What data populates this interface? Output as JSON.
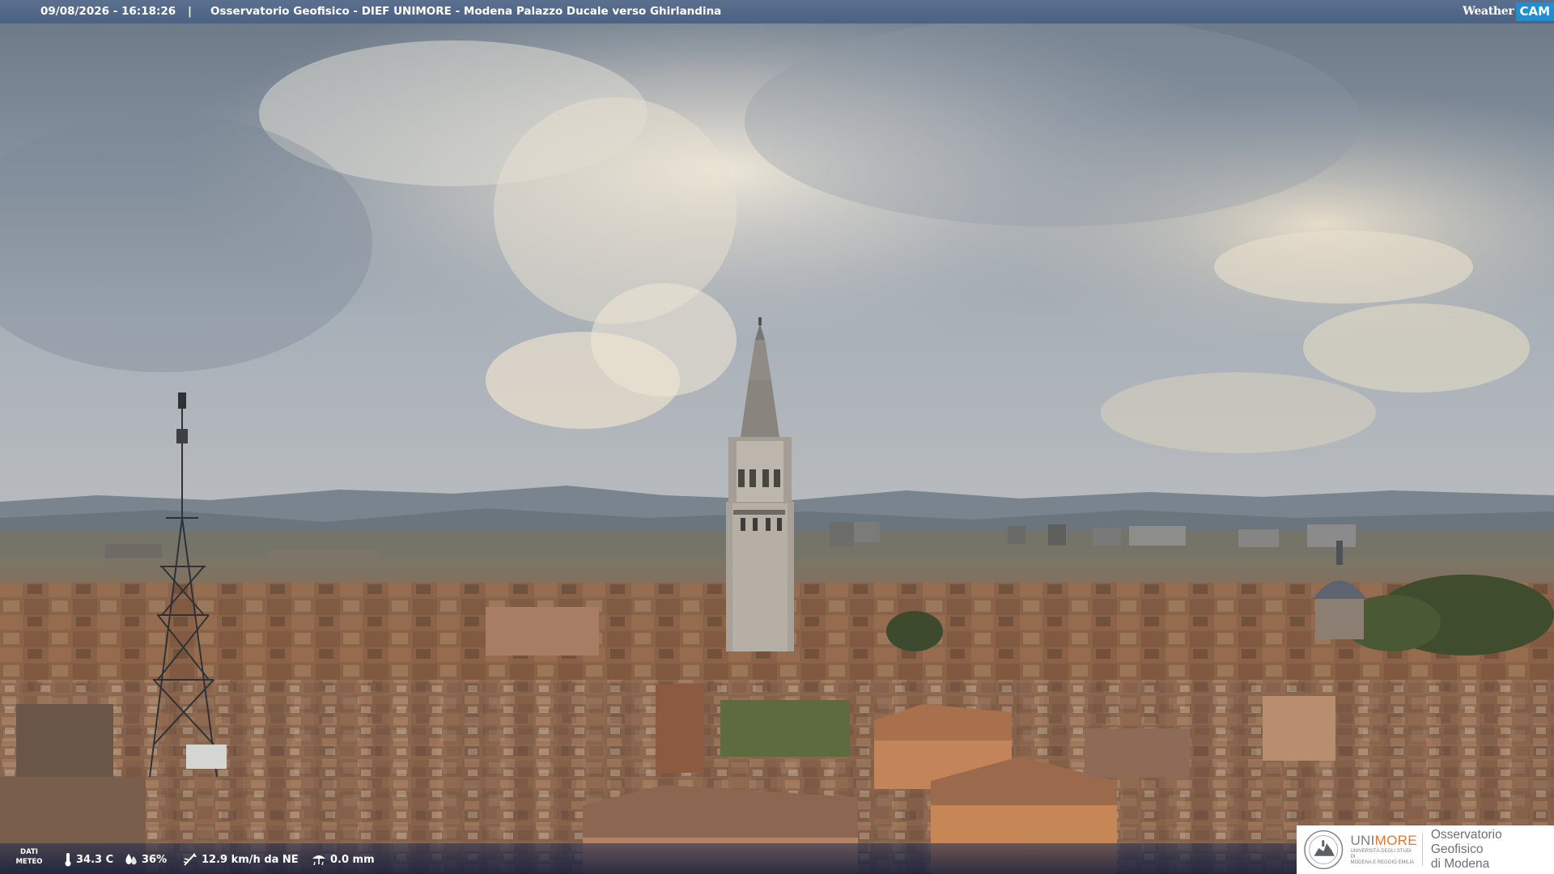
{
  "header": {
    "timestamp": "09/08/2026 - 16:18:26",
    "separator": "|",
    "caption": "Osservatorio Geofisico - DIEF UNIMORE - Modena Palazzo Ducale verso Ghirlandina"
  },
  "brand": {
    "word": "Weather",
    "cam": "CAM"
  },
  "meteo": {
    "label_line1": "DATI",
    "label_line2": "METEO",
    "temperature": "34.3 C",
    "humidity": "36%",
    "wind": "12.9 km/h da NE",
    "rain": "0.0 mm",
    "icons": [
      "thermometer-icon",
      "humidity-drop-icon",
      "wind-vane-icon",
      "rain-gauge-icon"
    ]
  },
  "logo": {
    "uni_part1": "UNI",
    "uni_part2": "MORE",
    "uni_sub1": "UNIVERSITÀ DEGLI STUDI DI",
    "uni_sub2": "MODENA E REGGIO EMILIA",
    "observatory_line1": "Osservatorio Geofisico",
    "observatory_line2": "di Modena"
  },
  "colors": {
    "header_bar": "#4f6586",
    "brand_cam": "#1e8fd2",
    "unimore_orange": "#e0782d"
  }
}
